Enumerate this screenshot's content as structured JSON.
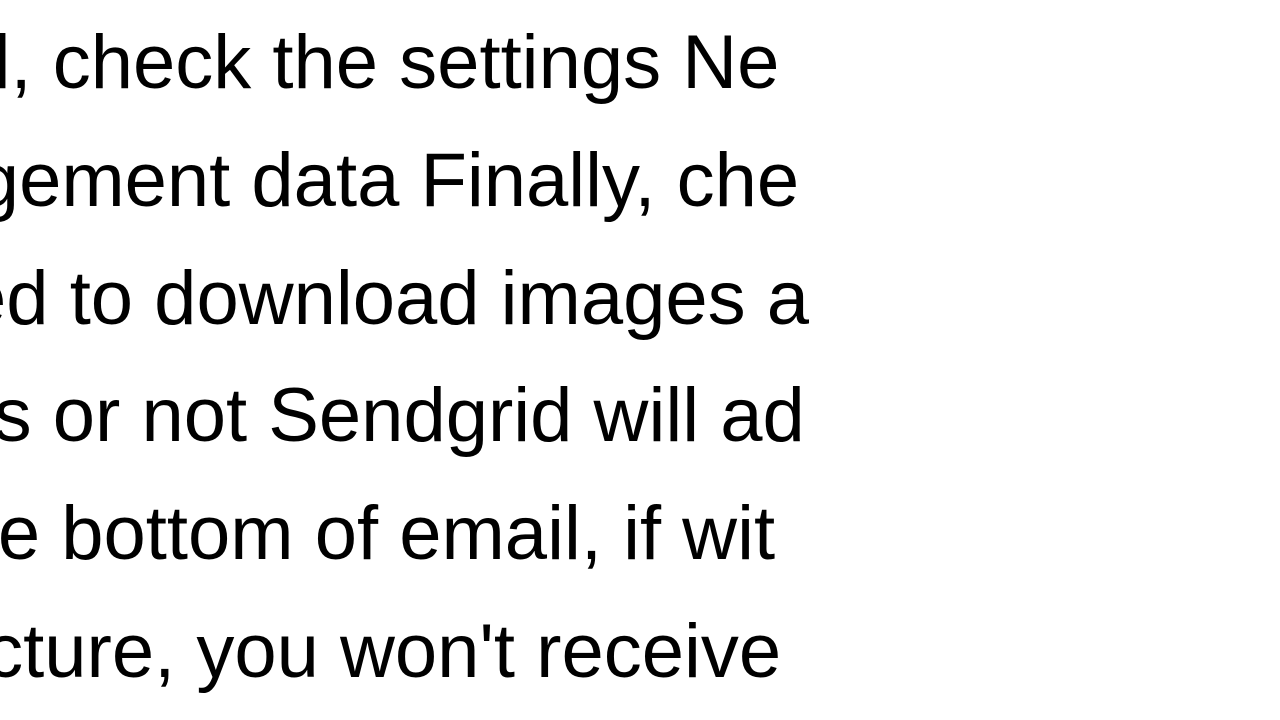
{
  "lines": {
    "l1": " of all, check the settings  Ne",
    "l2": "ngagement data  Finally, che",
    "l3": "lowed to download images a",
    "l4": "k ads or not Sendgrid will ad",
    "l5": " at the bottom of email, if wit",
    "l6": "is picture, you won't receive"
  }
}
